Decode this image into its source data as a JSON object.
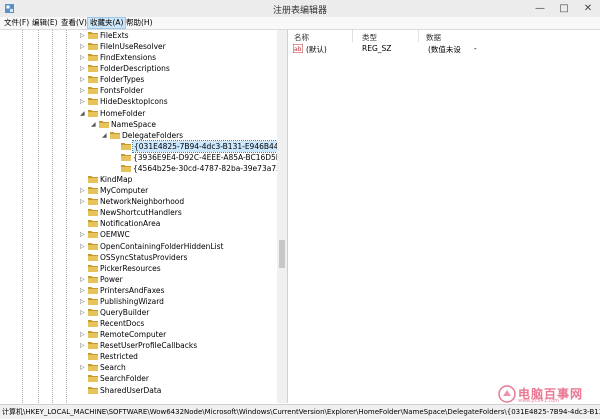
{
  "window": {
    "title": "注册表编辑器",
    "controls": {
      "minimize": "—",
      "maximize": "□",
      "close": "✕"
    }
  },
  "menu": [
    {
      "label": "文件(F)"
    },
    {
      "label": "编辑(E)"
    },
    {
      "label": "查看(V)"
    },
    {
      "label": "收藏夹(A)",
      "active": true
    },
    {
      "label": "帮助(H)"
    }
  ],
  "tree": {
    "items": [
      {
        "label": "FileExts",
        "level": 0,
        "expander": "▷"
      },
      {
        "label": "FileInUseResolver",
        "level": 0,
        "expander": "▷"
      },
      {
        "label": "FindExtensions",
        "level": 0,
        "expander": "▷"
      },
      {
        "label": "FolderDescriptions",
        "level": 0,
        "expander": "▷"
      },
      {
        "label": "FolderTypes",
        "level": 0,
        "expander": "▷"
      },
      {
        "label": "FontsFolder",
        "level": 0,
        "expander": "▷"
      },
      {
        "label": "HideDesktopIcons",
        "level": 0,
        "expander": "▷"
      },
      {
        "label": "HomeFolder",
        "level": 0,
        "expander": "◢"
      },
      {
        "label": "NameSpace",
        "level": 1,
        "expander": "◢"
      },
      {
        "label": "DelegateFolders",
        "level": 2,
        "expander": "◢"
      },
      {
        "label": "{031E4825-7B94-4dc3-B131-E946B44C8DD5}",
        "level": 3,
        "expander": "",
        "selected": true
      },
      {
        "label": "{3936E9E4-D92C-4EEE-A85A-BC16D5EA0819}",
        "level": 3,
        "expander": ""
      },
      {
        "label": "{4564b25e-30cd-4787-82ba-39e73a750b14}",
        "level": 3,
        "expander": ""
      },
      {
        "label": "KindMap",
        "level": 0,
        "expander": ""
      },
      {
        "label": "MyComputer",
        "level": 0,
        "expander": "▷"
      },
      {
        "label": "NetworkNeighborhood",
        "level": 0,
        "expander": "▷"
      },
      {
        "label": "NewShortcutHandlers",
        "level": 0,
        "expander": ""
      },
      {
        "label": "NotificationArea",
        "level": 0,
        "expander": ""
      },
      {
        "label": "OEMWC",
        "level": 0,
        "expander": "▷"
      },
      {
        "label": "OpenContainingFolderHiddenList",
        "level": 0,
        "expander": "▷"
      },
      {
        "label": "OSSyncStatusProviders",
        "level": 0,
        "expander": ""
      },
      {
        "label": "PickerResources",
        "level": 0,
        "expander": ""
      },
      {
        "label": "Power",
        "level": 0,
        "expander": "▷"
      },
      {
        "label": "PrintersAndFaxes",
        "level": 0,
        "expander": "▷"
      },
      {
        "label": "PublishingWizard",
        "level": 0,
        "expander": "▷"
      },
      {
        "label": "QueryBuilder",
        "level": 0,
        "expander": "▷"
      },
      {
        "label": "RecentDocs",
        "level": 0,
        "expander": ""
      },
      {
        "label": "RemoteComputer",
        "level": 0,
        "expander": "▷"
      },
      {
        "label": "ResetUserProfileCallbacks",
        "level": 0,
        "expander": "▷"
      },
      {
        "label": "Restricted",
        "level": 0,
        "expander": ""
      },
      {
        "label": "Search",
        "level": 0,
        "expander": "▷"
      },
      {
        "label": "SearchFolder",
        "level": 0,
        "expander": ""
      },
      {
        "label": "SharedUserData",
        "level": 0,
        "expander": ""
      }
    ]
  },
  "values_pane": {
    "headers": {
      "name": "名称",
      "type": "类型",
      "data": "数据"
    },
    "rows": [
      {
        "name": "(默认)",
        "type": "REG_SZ",
        "data": "(数值未设"
      }
    ],
    "trailing_mark": "-"
  },
  "status_path": "计算机\\HKEY_LOCAL_MACHINE\\SOFTWARE\\Wow6432Node\\Microsoft\\Windows\\CurrentVersion\\Explorer\\HomeFolder\\NameSpace\\DelegateFolders\\{031E4825-7B94-4dc3-B131-E946",
  "watermark": {
    "text": "电脑百事网",
    "sub": "www.pc841.com"
  },
  "colors": {
    "folder": "#e8c25a",
    "folder_dark": "#c79a2e",
    "selection": "#cce8ff",
    "accent": "#3c7fb1",
    "watermark": "#e34a6f"
  }
}
